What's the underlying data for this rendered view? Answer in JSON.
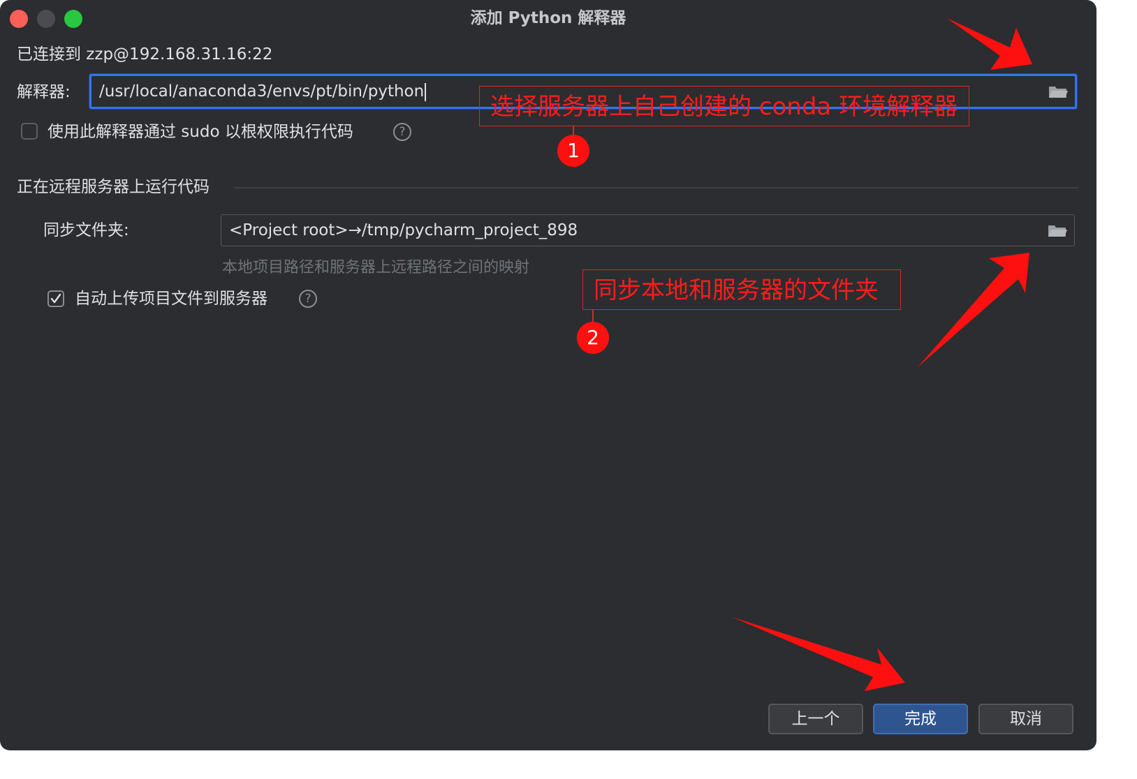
{
  "window": {
    "title": "添加 Python 解释器"
  },
  "connection": {
    "text": "已连接到 zzp@192.168.31.16:22"
  },
  "interpreter": {
    "label": "解释器:",
    "value": "/usr/local/anaconda3/envs/pt/bin/python",
    "sudo_label": "使用此解释器通过 sudo 以根权限执行代码",
    "sudo_checked": false
  },
  "section": {
    "title": "正在远程服务器上运行代码"
  },
  "sync": {
    "label": "同步文件夹:",
    "value": "<Project root>→/tmp/pycharm_project_898",
    "hint": "本地项目路径和服务器上远程路径之间的映射",
    "auto_upload_label": "自动上传项目文件到服务器",
    "auto_upload_checked": true
  },
  "help_glyph": "?",
  "buttons": {
    "previous": "上一个",
    "finish": "完成",
    "cancel": "取消"
  },
  "annotations": [
    {
      "number": "1",
      "text": "选择服务器上自己创建的 conda 环境解释器"
    },
    {
      "number": "2",
      "text": "同步本地和服务器的文件夹"
    }
  ],
  "colors": {
    "background": "#2b2d30",
    "accent": "#3574f0",
    "annotation": "#ff1c1c"
  }
}
